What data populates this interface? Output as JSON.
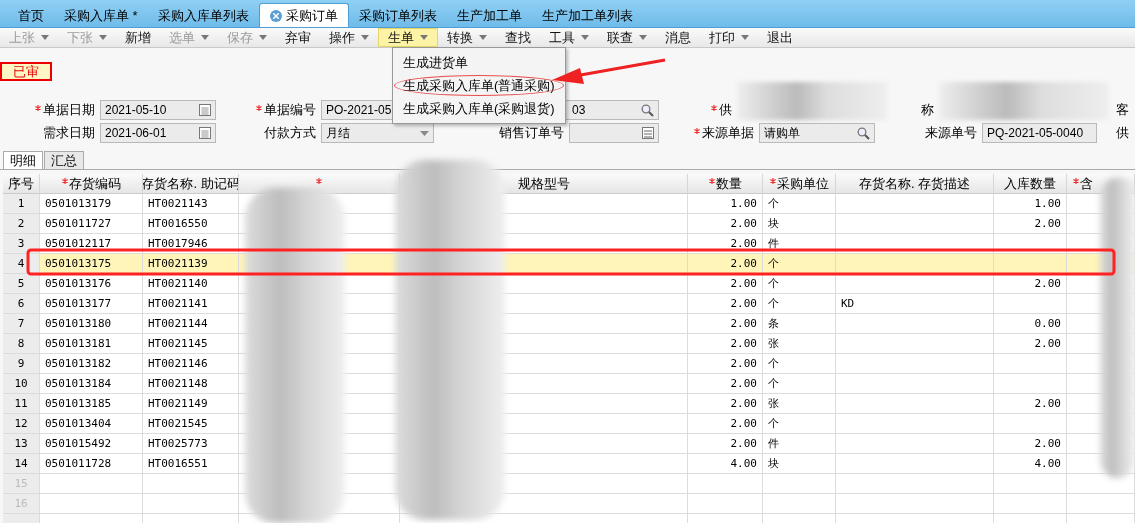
{
  "doc_tabs": [
    {
      "label": "首页",
      "selected": false,
      "closable": false
    },
    {
      "label": "采购入库单 *",
      "selected": false,
      "closable": false
    },
    {
      "label": "采购入库单列表",
      "selected": false,
      "closable": false
    },
    {
      "label": "采购订单",
      "selected": true,
      "closable": true
    },
    {
      "label": "采购订单列表",
      "selected": false,
      "closable": false
    },
    {
      "label": "生产加工单",
      "selected": false,
      "closable": false
    },
    {
      "label": "生产加工单列表",
      "selected": false,
      "closable": false
    }
  ],
  "toolbar": [
    {
      "label": "上张",
      "disabled": true,
      "has_menu": true,
      "open": false
    },
    {
      "label": "下张",
      "disabled": true,
      "has_menu": true,
      "open": false
    },
    {
      "label": "新增",
      "disabled": false,
      "has_menu": false,
      "open": false
    },
    {
      "label": "选单",
      "disabled": true,
      "has_menu": true,
      "open": false
    },
    {
      "label": "保存",
      "disabled": true,
      "has_menu": true,
      "open": false
    },
    {
      "label": "弃审",
      "disabled": false,
      "has_menu": false,
      "open": false
    },
    {
      "label": "操作",
      "disabled": false,
      "has_menu": true,
      "open": false
    },
    {
      "label": "生单",
      "disabled": false,
      "has_menu": true,
      "open": true
    },
    {
      "label": "转换",
      "disabled": false,
      "has_menu": true,
      "open": false
    },
    {
      "label": "查找",
      "disabled": false,
      "has_menu": false,
      "open": false
    },
    {
      "label": "工具",
      "disabled": false,
      "has_menu": true,
      "open": false
    },
    {
      "label": "联查",
      "disabled": false,
      "has_menu": true,
      "open": false
    },
    {
      "label": "消息",
      "disabled": false,
      "has_menu": false,
      "open": false
    },
    {
      "label": "打印",
      "disabled": false,
      "has_menu": true,
      "open": false
    },
    {
      "label": "退出",
      "disabled": false,
      "has_menu": false,
      "open": false
    }
  ],
  "menu": [
    {
      "label": "生成进货单",
      "highlighted": false
    },
    {
      "label": "生成采购入库单(普通采购)",
      "highlighted": true
    },
    {
      "label": "生成采购入库单(采购退货)",
      "highlighted": false
    }
  ],
  "status_badge": "已审",
  "form_row_1": [
    {
      "kind": "field",
      "label": "单据日期",
      "required": true,
      "value": "2021-05-10"
    },
    {
      "kind": "split",
      "label": "单据编号",
      "required": true,
      "value": "PO-2021-05",
      "value_end": "03"
    },
    {
      "kind": "redacted",
      "label": "供",
      "required": true,
      "label_end": "称"
    },
    {
      "kind": "cut",
      "label": "客"
    }
  ],
  "form_row_2": [
    {
      "kind": "field",
      "label": "需求日期",
      "required": false,
      "value": "2021-06-01"
    },
    {
      "kind": "field",
      "label": "付款方式",
      "required": false,
      "value": "月结"
    },
    {
      "kind": "field",
      "label": "销售订单号",
      "required": false
    },
    {
      "kind": "field",
      "label": "来源单据",
      "required": true,
      "value": "请购单"
    },
    {
      "kind": "field",
      "label": "来源单号",
      "required": false,
      "value": "PQ-2021-05-0040"
    },
    {
      "kind": "cut",
      "label": "供"
    }
  ],
  "detail_tabs": [
    {
      "label": "明细",
      "selected": true
    },
    {
      "label": "汇总",
      "selected": false
    }
  ],
  "table": {
    "columns": [
      {
        "label": "序号",
        "required": false
      },
      {
        "label": "存货编码",
        "required": true
      },
      {
        "label": "存货名称. 助记码",
        "required": false
      },
      {
        "required": true
      },
      {
        "label": "规格型号",
        "required": false
      },
      {
        "label": "数量",
        "required": true
      },
      {
        "label": "采购单位",
        "required": true
      },
      {
        "label": "存货名称. 存货描述",
        "required": false
      },
      {
        "label": "入库数量",
        "required": false
      },
      {
        "label": "含",
        "required": true
      }
    ],
    "rows": [
      {
        "cells": [
          "1",
          "0501013179",
          "HT0021143",
          "",
          "",
          "1.00",
          "个",
          "",
          "1.00",
          ""
        ],
        "selected": false
      },
      {
        "cells": [
          "2",
          "0501011727",
          "HT0016550",
          "",
          "",
          "2.00",
          "块",
          "",
          "2.00",
          ""
        ],
        "selected": false
      },
      {
        "cells": [
          "3",
          "0501012117",
          "HT0017946",
          "",
          "",
          "2.00",
          "件",
          "",
          "",
          ""
        ],
        "selected": false
      },
      {
        "cells": [
          "4",
          "0501013175",
          "HT0021139",
          "",
          "",
          "2.00",
          "个",
          "",
          "",
          ""
        ],
        "selected": true
      },
      {
        "cells": [
          "5",
          "0501013176",
          "HT0021140",
          "",
          "",
          "2.00",
          "个",
          "",
          "2.00",
          ""
        ],
        "selected": false
      },
      {
        "cells": [
          "6",
          "0501013177",
          "HT0021141",
          "",
          "",
          "2.00",
          "个",
          "KD",
          "",
          ""
        ],
        "selected": false
      },
      {
        "cells": [
          "7",
          "0501013180",
          "HT0021144",
          "",
          "",
          "2.00",
          "条",
          "",
          "0.00",
          ""
        ],
        "selected": false
      },
      {
        "cells": [
          "8",
          "0501013181",
          "HT0021145",
          "",
          "",
          "2.00",
          "张",
          "",
          "2.00",
          ""
        ],
        "selected": false
      },
      {
        "cells": [
          "9",
          "0501013182",
          "HT0021146",
          "",
          "",
          "2.00",
          "个",
          "",
          "",
          ""
        ],
        "selected": false
      },
      {
        "cells": [
          "10",
          "0501013184",
          "HT0021148",
          "",
          "",
          "2.00",
          "个",
          "",
          "",
          ""
        ],
        "selected": false
      },
      {
        "cells": [
          "11",
          "0501013185",
          "HT0021149",
          "",
          "",
          "2.00",
          "张",
          "",
          "2.00",
          ""
        ],
        "selected": false
      },
      {
        "cells": [
          "12",
          "0501013404",
          "HT0021545",
          "",
          "",
          "2.00",
          "个",
          "",
          "",
          ""
        ],
        "selected": false
      },
      {
        "cells": [
          "13",
          "0501015492",
          "HT0025773",
          "",
          "",
          "2.00",
          "件",
          "",
          "2.00",
          ""
        ],
        "selected": false
      },
      {
        "cells": [
          "14",
          "0501011728",
          "HT0016551",
          "",
          "",
          "4.00",
          "块",
          "",
          "4.00",
          ""
        ],
        "selected": false
      },
      {
        "cells": [
          "15",
          "",
          "",
          "",
          "",
          "",
          "",
          "",
          "",
          ""
        ],
        "selected": false
      },
      {
        "cells": [
          "16",
          "",
          "",
          "",
          "",
          "",
          "",
          "",
          "",
          ""
        ],
        "selected": false
      }
    ]
  }
}
